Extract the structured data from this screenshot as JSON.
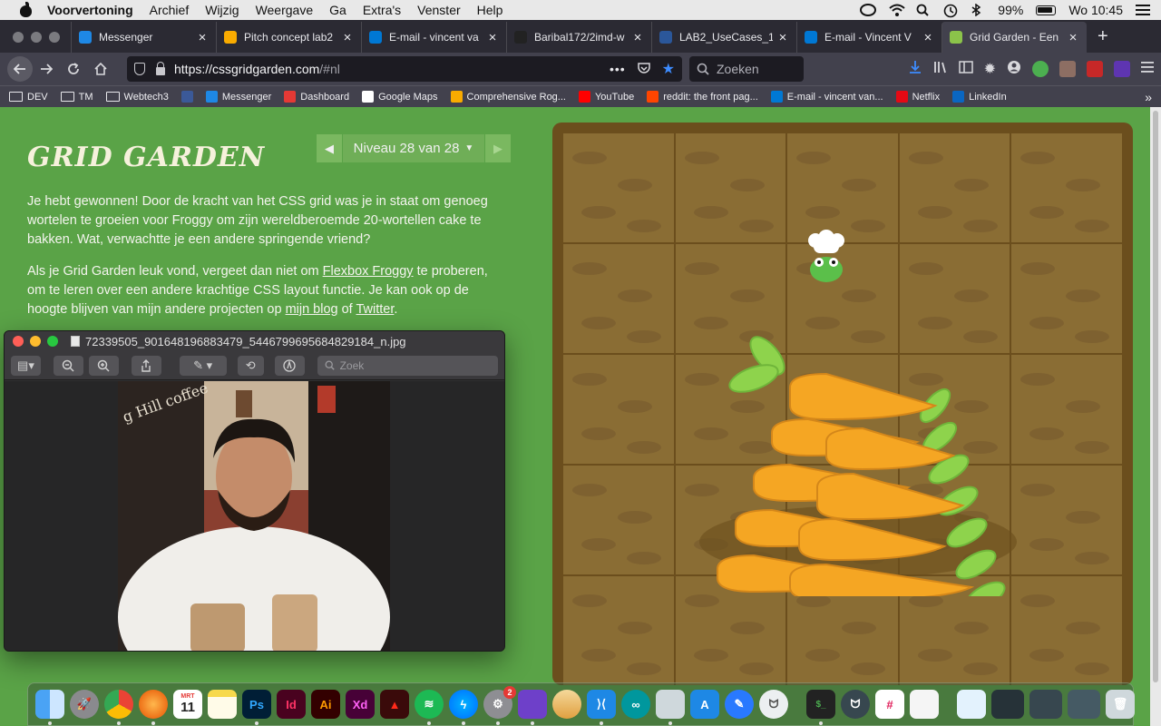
{
  "menubar": {
    "app": "Voorvertoning",
    "items": [
      "Archief",
      "Wijzig",
      "Weergave",
      "Ga",
      "Extra's",
      "Venster",
      "Help"
    ],
    "battery": "99%",
    "clock": "Wo 10:45"
  },
  "tabs": [
    {
      "label": "Messenger",
      "color": "#1e88e5"
    },
    {
      "label": "Pitch concept lab2",
      "color": "#f9ab00"
    },
    {
      "label": "E-mail - vincent va",
      "color": "#0078d4"
    },
    {
      "label": "Baribal172/2imd-w",
      "color": "#222222"
    },
    {
      "label": "LAB2_UseCases_1",
      "color": "#2b579a"
    },
    {
      "label": "E-mail - Vincent V",
      "color": "#0078d4"
    },
    {
      "label": "Grid Garden - Een",
      "color": "#8bc34a",
      "active": true
    }
  ],
  "toolbar": {
    "url_host": "https://cssgridgarden.com",
    "url_path": "/#nl",
    "search_placeholder": "Zoeken"
  },
  "bookmarks": [
    {
      "label": "DEV",
      "type": "folder"
    },
    {
      "label": "TM",
      "type": "folder"
    },
    {
      "label": "Webtech3",
      "type": "folder"
    },
    {
      "label": "",
      "type": "icon",
      "color": "#3b5998"
    },
    {
      "label": "Messenger",
      "type": "icon",
      "color": "#1e88e5"
    },
    {
      "label": "Dashboard",
      "type": "icon",
      "color": "#e53935"
    },
    {
      "label": "Google Maps",
      "type": "icon",
      "color": "#ffffff"
    },
    {
      "label": "Comprehensive Rog...",
      "type": "icon",
      "color": "#f9ab00"
    },
    {
      "label": "YouTube",
      "type": "icon",
      "color": "#ff0000"
    },
    {
      "label": "reddit: the front pag...",
      "type": "icon",
      "color": "#ff4500"
    },
    {
      "label": "E-mail - vincent van...",
      "type": "icon",
      "color": "#0078d4"
    },
    {
      "label": "Netflix",
      "type": "icon",
      "color": "#e50914"
    },
    {
      "label": "LinkedIn",
      "type": "icon",
      "color": "#0a66c2"
    }
  ],
  "game": {
    "title": "GRID GARDEN",
    "level_label": "Niveau 28 van 28",
    "p1": "Je hebt gewonnen! Door de kracht van het CSS grid was je in staat om genoeg wortelen te groeien voor Froggy om zijn wereldberoemde 20-wortellen cake te bakken. Wat, verwachtte je een andere springende vriend?",
    "p2_a": "Als je Grid Garden leuk vond, vergeet dan niet om ",
    "link_flexbox": "Flexbox Froggy",
    "p2_b": " te proberen, om te leren over een andere krachtige CSS layout functie. Je kan ook op de hoogte blijven van mijn andere projecten op ",
    "link_blog": "mijn blog",
    "p2_c": " of ",
    "link_twitter": "Twitter",
    "p2_d": "."
  },
  "preview": {
    "filename": "72339505_901648196883479_5446799695684829184_n.jpg",
    "search_placeholder": "Zoek",
    "photo_sign": "g Hill coffee"
  },
  "dock": {
    "calendar_day": "11",
    "calendar_month": "MRT",
    "notification_badge": "2"
  },
  "colors": {
    "page_bg": "#5aa347",
    "garden_border": "#6b4e1d",
    "soil": "#8a6d34",
    "carrot": "#f5a623",
    "leaf": "#8ed34c"
  }
}
